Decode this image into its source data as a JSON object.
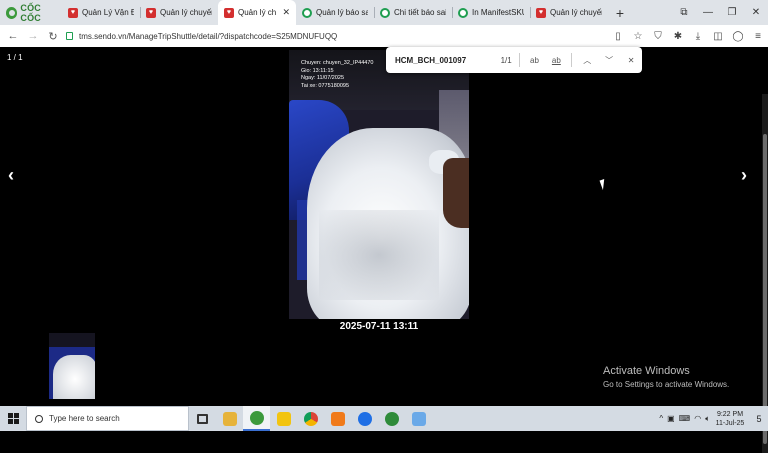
{
  "browser": {
    "brand": "CỐC CỐC",
    "tabs": [
      {
        "label": "Quản Lý Vận Đơ",
        "icon": "red-brand-icon",
        "active": false
      },
      {
        "label": "Quản lý chuyến",
        "icon": "red-brand-icon",
        "active": false
      },
      {
        "label": "Quản lý chu",
        "icon": "red-brand-icon",
        "active": true
      },
      {
        "label": "Quản lý báo sai",
        "icon": "green-sheet-icon",
        "active": false
      },
      {
        "label": "Chi tiết báo sai",
        "icon": "green-sheet-icon",
        "active": false
      },
      {
        "label": "In ManifestSKUs",
        "icon": "green-sheet-icon",
        "active": false
      },
      {
        "label": "Quản lý chuyến",
        "icon": "red-brand-icon",
        "active": false
      }
    ],
    "new_tab": "+",
    "url": "tms.sendo.vn/ManageTripShuttle/detail/?dispatchcode=S25MDNUFUQQ",
    "accent": "#3a6fd1"
  },
  "find_bar": {
    "query": "HCM_BCH_001097",
    "count": "1/1",
    "match_case": "ab",
    "whole_word": "ab"
  },
  "viewer": {
    "counter": "1 / 1",
    "prev": "‹",
    "next": "›",
    "stamp": {
      "line1": "Chuyen: chuyen_32_IP44470",
      "line2": "Gio: 13:11:15",
      "line3": "Ngay: 11/07/2025",
      "line4": "Tai xe: 0775180095"
    },
    "caption": "2025-07-11 13:11"
  },
  "watermark": {
    "title": "Activate Windows",
    "subtitle": "Go to Settings to activate Windows."
  },
  "taskbar": {
    "search_placeholder": "Type here to search",
    "time": "9:22 PM",
    "date": "11-Jul-25",
    "notification_count": "5"
  }
}
